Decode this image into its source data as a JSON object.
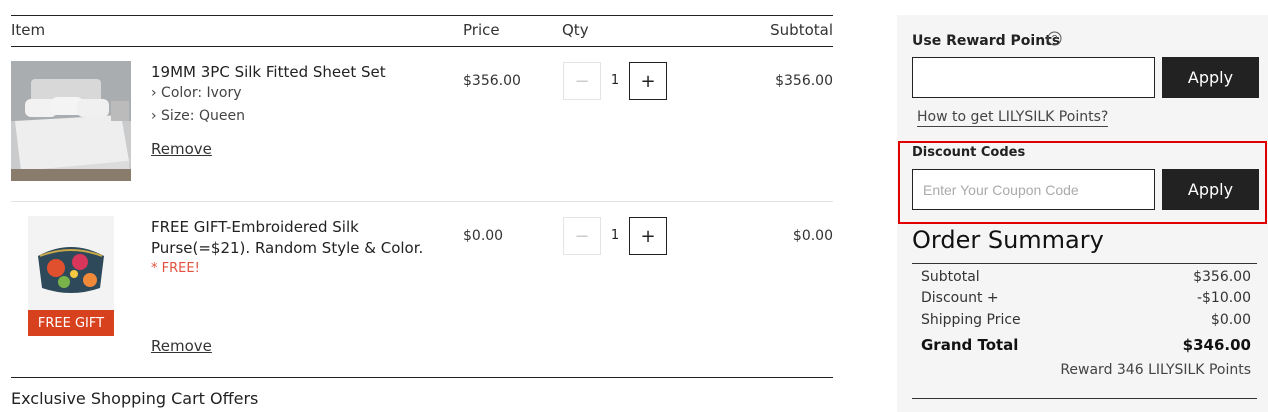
{
  "table": {
    "headers": {
      "item": "Item",
      "price": "Price",
      "qty": "Qty",
      "subtotal": "Subtotal"
    },
    "items": [
      {
        "name": "19MM 3PC Silk Fitted Sheet Set",
        "attributes": [
          "› Color:  Ivory",
          "› Size:  Queen"
        ],
        "remove": "Remove",
        "price": "$356.00",
        "qty_minus": "−",
        "qty": "1",
        "qty_plus": "+",
        "subtotal": "$356.00"
      },
      {
        "name_line1": "FREE GIFT-Embroidered Silk",
        "name_line2": "Purse(=$21). Random Style & Color.",
        "free_note": "* FREE!",
        "badge": "FREE GIFT",
        "remove": "Remove",
        "price": "$0.00",
        "qty_minus": "−",
        "qty": "1",
        "qty_plus": "+",
        "subtotal": "$0.00"
      }
    ],
    "offers_title": "Exclusive Shopping Cart Offers"
  },
  "panel": {
    "reward_label": "Use Reward Points",
    "reward_help_icon": "question-circle-icon",
    "reward_input_value": "",
    "reward_apply": "Apply",
    "reward_link": "How to get LILYSILK Points?",
    "discount_label": "Discount Codes",
    "discount_placeholder": "Enter Your Coupon Code",
    "discount_apply": "Apply",
    "highlight_color": "#e00000"
  },
  "summary": {
    "title": "Order Summary",
    "rows": [
      {
        "label": "Subtotal",
        "value": "$356.00"
      },
      {
        "label": "Discount +",
        "value": "-$10.00"
      },
      {
        "label": "Shipping Price",
        "value": "$0.00"
      }
    ],
    "total_label": "Grand Total",
    "total_value": "$346.00",
    "reward_note": "Reward 346 LILYSILK Points"
  }
}
